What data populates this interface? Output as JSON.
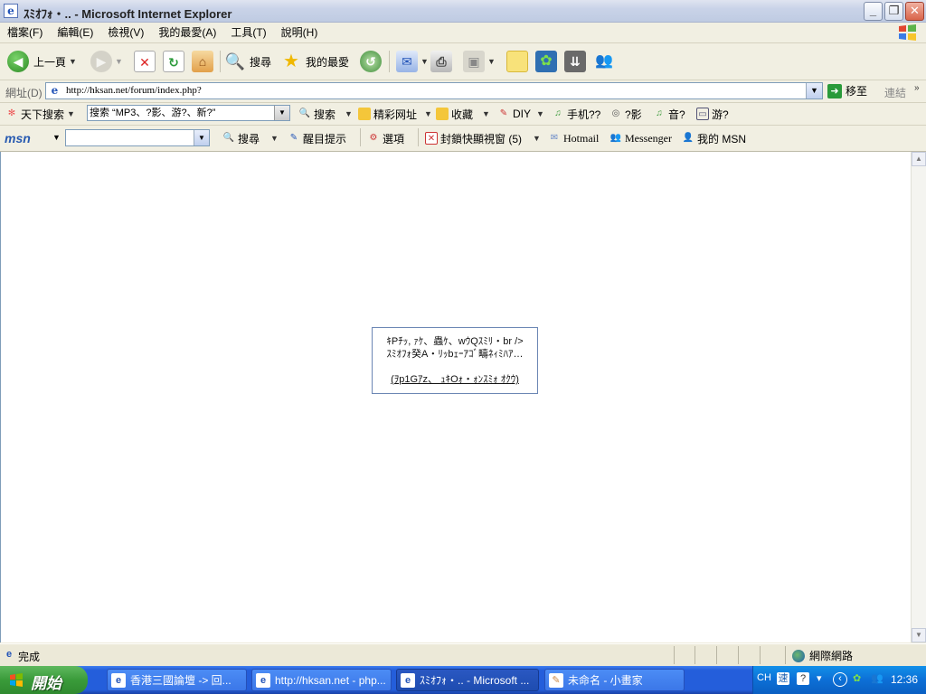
{
  "window": {
    "title": "ｽﾐｵﾌｫ・.. - Microsoft Internet Explorer",
    "buttons": {
      "minimize": "_",
      "maximize": "❐",
      "close": "✕"
    }
  },
  "menu": [
    "檔案(F)",
    "編輯(E)",
    "檢視(V)",
    "我的最愛(A)",
    "工具(T)",
    "說明(H)"
  ],
  "toolbar": {
    "back_label": "上一頁",
    "search_label": "搜尋",
    "favorites_label": "我的最愛"
  },
  "address": {
    "label": "網址(D)",
    "url": "http://hksan.net/forum/index.php?",
    "go_label": "移至",
    "links_label": "連結"
  },
  "search_toolbar": {
    "brand": "天下搜索",
    "query": "搜索 “MP3、?影、游?、新?”",
    "search_btn": "搜索",
    "items": [
      "精彩网址",
      "收藏",
      "DIY",
      "手机??",
      "?影",
      "音?",
      "游?"
    ]
  },
  "msn_toolbar": {
    "logo": "msn",
    "search_label": "搜尋",
    "reminder_label": "醒目提示",
    "options_label": "選項",
    "popup_blocker_label": "封鎖快顯視窗 (5)",
    "hotmail_label": "Hotmail",
    "messenger_label": "Messenger",
    "mymsn_label": "我的 MSN"
  },
  "content": {
    "notice_line1": "ｷPﾁｯ, ｧｹ、蟲ｹ、wｳQｽﾐﾘ・br />",
    "notice_line2": "ｽﾐｵﾌｫ癸A・ﾘｯbｪｰｱｺﾞ疇ﾈｨﾐﾊｱ…",
    "notice_link": "(ｦp1Gｱz、 ｭｷOｫ・ｫﾝｽﾐｫ  ｵｸｳ)"
  },
  "status": {
    "text": "完成",
    "zone": "網際網路"
  },
  "taskbar": {
    "start_label": "開始",
    "tasks": [
      "香港三國論壇 -> 回...",
      "http://hksan.net - php...",
      "ｽﾐｵﾌｫ・.. - Microsoft ...",
      "未命名 - 小畫家"
    ],
    "tray_lang": "CH",
    "clock": "12:36"
  }
}
